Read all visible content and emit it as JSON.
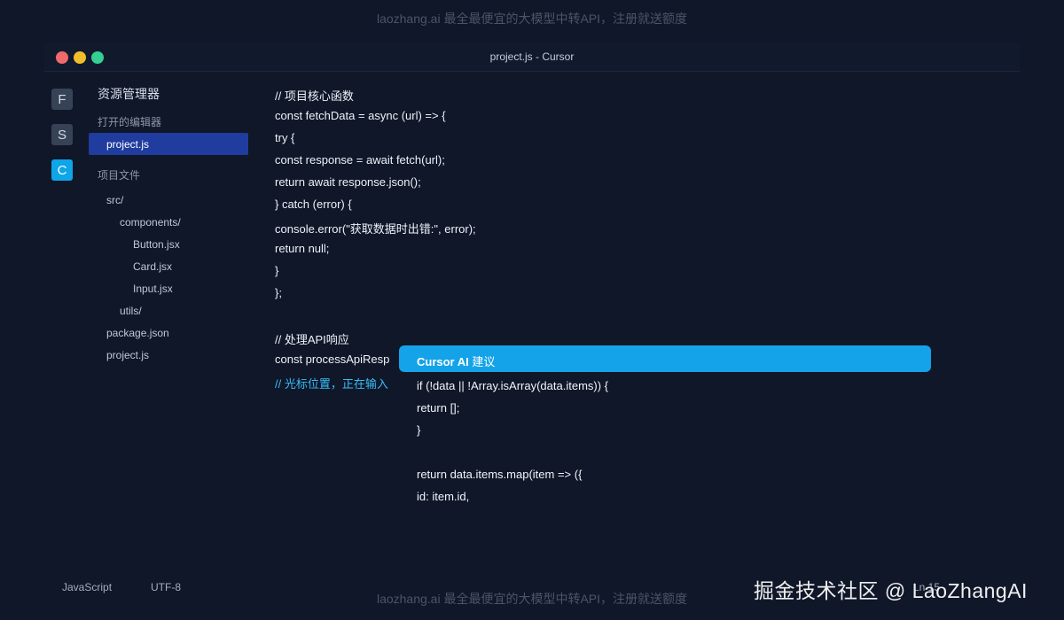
{
  "watermark": {
    "top": "laozhang.ai 最全最便宜的大模型中转API，注册就送额度",
    "bottom": "laozhang.ai 最全最便宜的大模型中转API，注册就送额度"
  },
  "window": {
    "title": "project.js - Cursor",
    "traffic_lights": [
      "close",
      "minimize",
      "maximize"
    ]
  },
  "activity_bar": {
    "items": [
      {
        "label": "F",
        "active": false
      },
      {
        "label": "S",
        "active": false
      },
      {
        "label": "C",
        "active": true
      }
    ]
  },
  "explorer": {
    "title": "资源管理器",
    "open_editors_label": "打开的编辑器",
    "open_editors": [
      "project.js"
    ],
    "project_files_label": "项目文件",
    "tree": [
      {
        "name": "src/",
        "depth": 0
      },
      {
        "name": "components/",
        "depth": 1
      },
      {
        "name": "Button.jsx",
        "depth": 2
      },
      {
        "name": "Card.jsx",
        "depth": 2
      },
      {
        "name": "Input.jsx",
        "depth": 2
      },
      {
        "name": "utils/",
        "depth": 1
      },
      {
        "name": "package.json",
        "depth": 0
      },
      {
        "name": "project.js",
        "depth": 0
      }
    ]
  },
  "editor": {
    "lines": [
      "// 项目核心函数",
      "const fetchData = async (url) => {",
      "try {",
      "const response = await fetch(url);",
      "return await response.json();",
      "} catch (error) {",
      "console.error(\"获取数据时出错:\", error);",
      "return null;",
      "}",
      "};",
      "",
      "// 处理API响应",
      "const processApiResp",
      "// 光标位置，正在输入"
    ]
  },
  "ai_suggestion": {
    "title_brand": "Cursor AI",
    "title_suffix": " 建议",
    "lines": [
      "if (!data || !Array.isArray(data.items)) {",
      "return [];",
      "}",
      "",
      "return data.items.map(item => ({",
      "id: item.id,"
    ]
  },
  "status_bar": {
    "language": "JavaScript",
    "encoding": "UTF-8",
    "position": "Ln 15"
  },
  "overlay": {
    "juejin": "掘金技术社区 @ LaoZhangAI"
  },
  "colors": {
    "background": "#0f1729",
    "accent": "#0ea5e9",
    "selection": "#1f3c9e",
    "ai_header": "#14a3e8",
    "comment": "#38bdf8"
  }
}
